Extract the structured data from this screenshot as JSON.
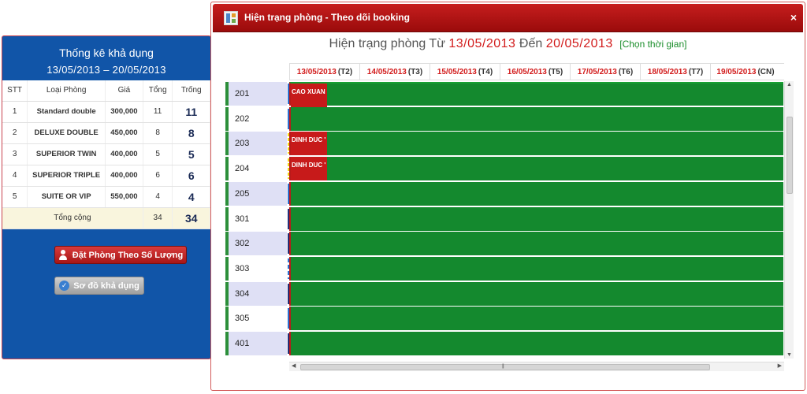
{
  "left_panel": {
    "title": "Thống kê khả dụng",
    "date_range": "13/05/2013 – 20/05/2013",
    "columns": [
      "STT",
      "Loại Phòng",
      "Giá",
      "Tổng",
      "Trống"
    ],
    "rows": [
      {
        "stt": "1",
        "name": "Standard double",
        "price": "300,000",
        "total": "11",
        "avail": "11"
      },
      {
        "stt": "2",
        "name": "DELUXE DOUBLE",
        "price": "450,000",
        "total": "8",
        "avail": "8"
      },
      {
        "stt": "3",
        "name": "SUPERIOR TWIN",
        "price": "400,000",
        "total": "5",
        "avail": "5"
      },
      {
        "stt": "4",
        "name": "SUPERIOR TRIPLE",
        "price": "400,000",
        "total": "6",
        "avail": "6"
      },
      {
        "stt": "5",
        "name": "SUITE OR VIP",
        "price": "550,000",
        "total": "4",
        "avail": "4"
      }
    ],
    "total_row": {
      "label": "Tổng cộng",
      "total": "34",
      "avail": "34"
    },
    "book_button_label": "Đặt Phòng Theo Số Lượng",
    "map_button_label": "Sơ đồ khả dụng"
  },
  "dialog": {
    "title": "Hiện trạng phòng - Theo dõi booking",
    "close_label": "×",
    "range_prefix": "Hiện trạng phòng Từ",
    "range_from": "13/05/2013",
    "range_mid": "Đến",
    "range_to": "20/05/2013",
    "choose_time_label": "[Chọn thời gian]"
  },
  "dates": [
    {
      "date": "13/05/2013",
      "weekday": "(T2)"
    },
    {
      "date": "14/05/2013",
      "weekday": "(T3)"
    },
    {
      "date": "15/05/2013",
      "weekday": "(T4)"
    },
    {
      "date": "16/05/2013",
      "weekday": "(T5)"
    },
    {
      "date": "17/05/2013",
      "weekday": "(T6)"
    },
    {
      "date": "18/05/2013",
      "weekday": "(T7)"
    },
    {
      "date": "19/05/2013",
      "weekday": "(CN)"
    }
  ],
  "rooms": [
    {
      "number": "201",
      "booking": "CAO XUAN I",
      "mark": "blue"
    },
    {
      "number": "202",
      "booking": "",
      "mark": "blue"
    },
    {
      "number": "203",
      "booking": "DINH DUC '",
      "mark": "yellow"
    },
    {
      "number": "204",
      "booking": "DINH DUC '",
      "mark": "yellow"
    },
    {
      "number": "205",
      "booking": "",
      "mark": "blue"
    },
    {
      "number": "301",
      "booking": "",
      "mark": "dark"
    },
    {
      "number": "302",
      "booking": "",
      "mark": "dark"
    },
    {
      "number": "303",
      "booking": "",
      "mark": "dash"
    },
    {
      "number": "304",
      "booking": "",
      "mark": "dark"
    },
    {
      "number": "305",
      "booking": "",
      "mark": "blue"
    },
    {
      "number": "401",
      "booking": "",
      "mark": "dark"
    }
  ],
  "colors": {
    "panel_blue": "#1155a8",
    "titlebar_red": "#b01414",
    "date_red": "#d21b1b",
    "available_green": "#14892e",
    "booked_red": "#c71a1a",
    "link_green": "#1a8d2a"
  },
  "icons": {
    "dialog_icon": "room-grid-icon",
    "book_icon": "user-icon",
    "map_icon": "check-circle-icon"
  }
}
